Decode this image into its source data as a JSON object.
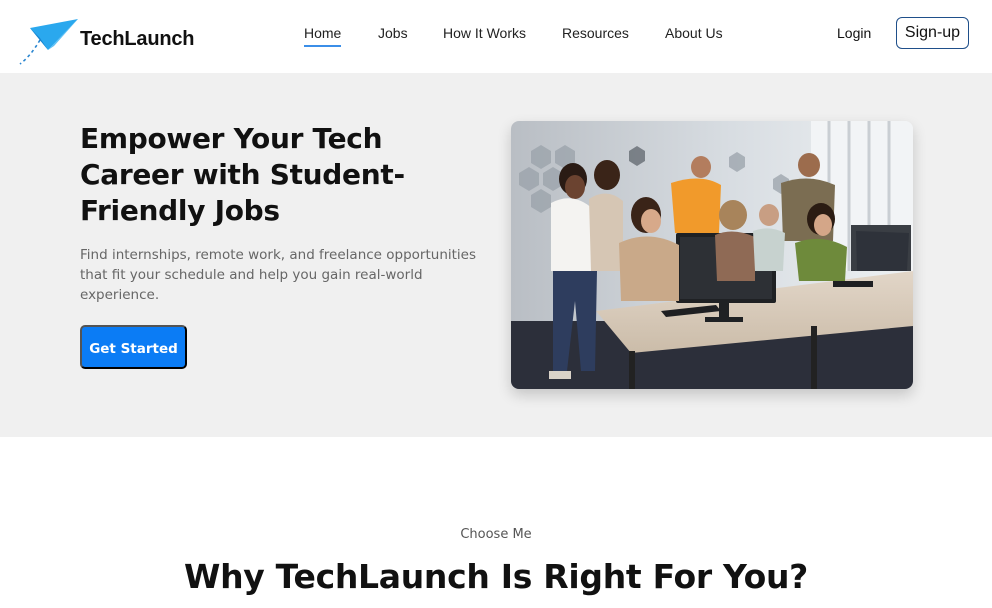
{
  "brand": {
    "name": "TechLaunch",
    "icon": "paper-plane-icon",
    "color": "#1e9be8"
  },
  "nav": {
    "items": [
      {
        "label": "Home",
        "active": true
      },
      {
        "label": "Jobs",
        "active": false
      },
      {
        "label": "How It Works",
        "active": false
      },
      {
        "label": "Resources",
        "active": false
      },
      {
        "label": "About Us",
        "active": false
      }
    ],
    "login_label": "Login",
    "signup_label": "Sign-up"
  },
  "hero": {
    "title": "Empower Your Tech Career with Student-Friendly Jobs",
    "description": "Find internships, remote work, and freelance opportunities that fit your schedule and help you gain real-world experience.",
    "cta_label": "Get Started",
    "image": "students-working-at-computers-photo"
  },
  "why": {
    "eyebrow": "Choose Me",
    "title": "Why TechLaunch Is Right For You?"
  },
  "colors": {
    "accent": "#0b7cf5",
    "hero_bg": "#f0f0f0",
    "active_underline": "#3b8ee8"
  }
}
